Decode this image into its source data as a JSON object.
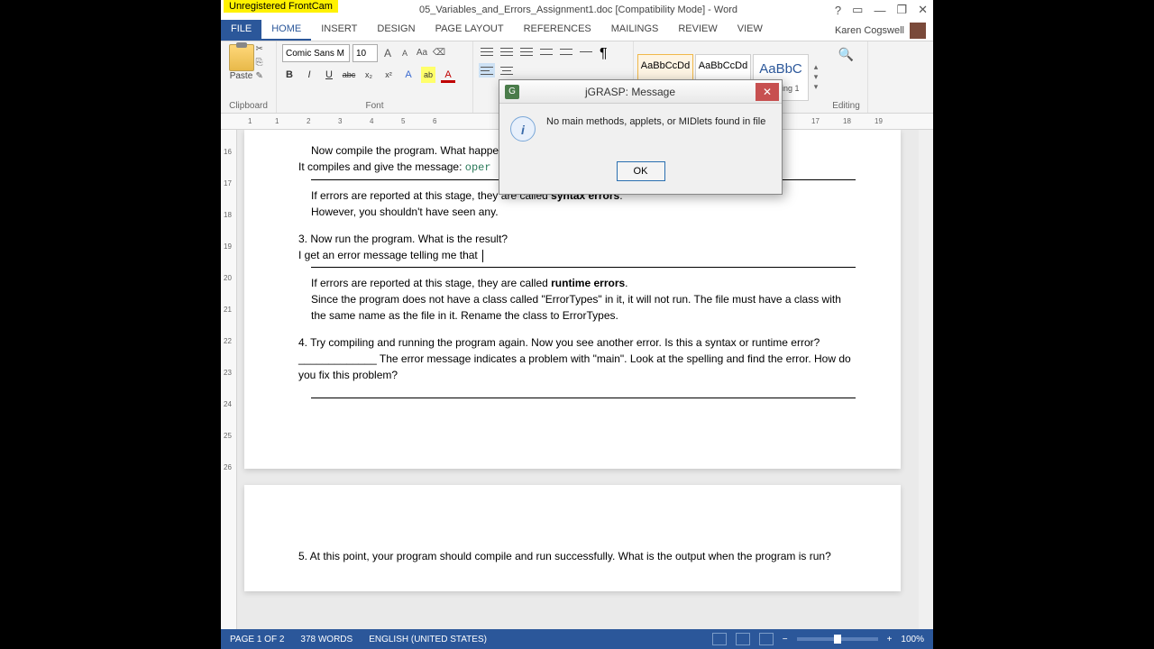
{
  "frontcam_badge": "Unregistered FrontCam",
  "title": "05_Variables_and_Errors_Assignment1.doc [Compatibility Mode] - Word",
  "win_help": "?",
  "win_ribbon": "▭",
  "win_min": "—",
  "win_restore": "❐",
  "win_close": "✕",
  "tabs": {
    "file": "FILE",
    "home": "HOME",
    "insert": "INSERT",
    "design": "DESIGN",
    "page_layout": "PAGE LAYOUT",
    "references": "REFERENCES",
    "mailings": "MAILINGS",
    "review": "REVIEW",
    "view": "VIEW"
  },
  "user_name": "Karen Cogswell",
  "ribbon": {
    "paste_label": "Paste",
    "clipboard_label": "Clipboard",
    "font_name": "Comic Sans M",
    "font_size": "10",
    "font_label": "Font",
    "grow_font": "A",
    "shrink_font": "A",
    "change_case": "Aa",
    "clear_fmt": "⌫",
    "bold": "B",
    "italic": "I",
    "underline": "U",
    "strike": "abc",
    "sub": "x₂",
    "sup": "x²",
    "text_effects": "A",
    "highlight": "ab",
    "font_color": "A",
    "style1_preview": "AaBbCcDd",
    "style2_preview": "AaBbCcDd",
    "style3_preview": "AaBbC",
    "style3_name": "Heading 1",
    "editing_label": "Editing"
  },
  "ruler_marks": [
    "1",
    "·",
    "1",
    "·",
    "2",
    "·",
    "3",
    "·",
    "4",
    "·",
    "5",
    "·",
    "6",
    "·",
    "17",
    "·",
    "18",
    "·",
    "19"
  ],
  "vruler_marks": [
    "16",
    "17",
    "18",
    "19",
    "20",
    "21",
    "22",
    "23",
    "24",
    "25",
    "26"
  ],
  "document": {
    "line1": "Now compile the program.  What happe",
    "line2a": "It compiles and give the message:  ",
    "line2b": "oper",
    "line3a": "If errors are reported at this stage, they are called ",
    "line3b": "syntax errors",
    "line3c": ".",
    "line4": "However, you shouldn't have seen any.",
    "line5": "3.  Now run the program.  What is the result?",
    "line6": "I get an error message telling me that ",
    "line7a": "If errors are reported at this stage, they are called ",
    "line7b": "runtime errors",
    "line7c": ".",
    "line8": "Since the program does not have a class called \"ErrorTypes\" in it, it will not run.  The file must have a class with the same name as the file in it.  Rename the class to ErrorTypes.",
    "line9": "4.  Try compiling and running the program again.  Now you see another error.  Is this a syntax or runtime error? _____________   The error message indicates a problem with \"main\".  Look at the spelling and find the error.  How do you fix this problem?",
    "line10": "5.  At this point, your program should compile and run successfully.  What is the output when the program is run?"
  },
  "dialog": {
    "title": "jGRASP: Message",
    "icon_badge": "G",
    "message": "No main methods, applets, or MIDlets found in file",
    "ok": "OK",
    "close": "✕",
    "info_glyph": "i"
  },
  "statusbar": {
    "page": "PAGE 1 OF 2",
    "words": "378 WORDS",
    "lang": "ENGLISH (UNITED STATES)",
    "zoom_minus": "−",
    "zoom_plus": "+",
    "zoom_pct": "100%"
  }
}
